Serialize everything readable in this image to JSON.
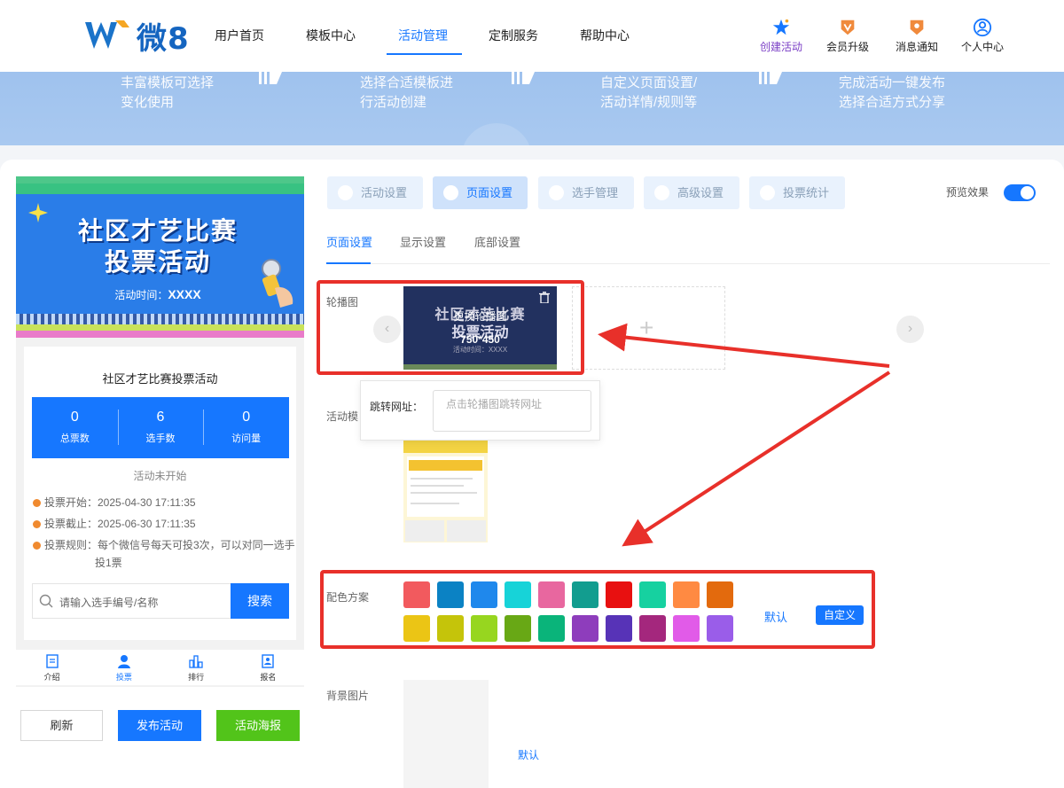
{
  "brand": {
    "logo_text": "微8"
  },
  "nav": {
    "items": [
      "用户首页",
      "模板中心",
      "活动管理",
      "定制服务",
      "帮助中心"
    ],
    "active": "活动管理",
    "right": [
      {
        "label": "创建活动",
        "icon": "star-icon"
      },
      {
        "label": "会员升级",
        "icon": "vip-badge-icon"
      },
      {
        "label": "消息通知",
        "icon": "bell-badge-icon"
      },
      {
        "label": "个人中心",
        "icon": "user-icon"
      }
    ]
  },
  "banner": {
    "steps": [
      [
        "丰富模板可选择",
        "变化使用"
      ],
      [
        "选择合适模板进",
        "行活动创建"
      ],
      [
        "自定义页面设置/",
        "活动详情/规则等"
      ],
      [
        "完成活动一键发布",
        "选择合适方式分享"
      ]
    ]
  },
  "preview": {
    "poster_title_1": "社区才艺比赛",
    "poster_title_2": "投票活动",
    "poster_time_label": "活动时间：",
    "poster_time_value": "XXXX",
    "activity_title": "社区才艺比赛投票活动",
    "stats": [
      {
        "value": "0",
        "label": "总票数"
      },
      {
        "value": "6",
        "label": "选手数"
      },
      {
        "value": "0",
        "label": "访问量"
      }
    ],
    "status": "活动未开始",
    "rules": [
      "投票开始：2025-04-30 17:11:35",
      "投票截止：2025-06-30 17:11:35",
      "投票规则：每个微信号每天可投3次，可以对同一选手",
      "投1票"
    ],
    "search_placeholder": "请输入选手编号/名称",
    "search_button": "搜索",
    "tabs": [
      "介绍",
      "投票",
      "排行",
      "报名"
    ],
    "active_tab": "投票"
  },
  "actions": {
    "refresh": "刷新",
    "publish": "发布活动",
    "poster": "活动海报"
  },
  "settings": {
    "top_tabs": [
      "活动设置",
      "页面设置",
      "选手管理",
      "高级设置",
      "投票统计"
    ],
    "active_top_tab": "页面设置",
    "preview_label": "预览效果",
    "preview_on": true,
    "sub_tabs": [
      "页面设置",
      "显示设置",
      "底部设置"
    ],
    "active_sub_tab": "页面设置",
    "carousel_label": "轮播图",
    "carousel_overlay_1": "更换轮播图",
    "carousel_overlay_2": "750*450",
    "carousel_img_title_1": "社区才艺比赛",
    "carousel_img_title_2": "投票活动",
    "carousel_img_time": "活动时间：XXXX",
    "carousel_add": "+",
    "jump_label": "跳转网址：",
    "jump_placeholder": "点击轮播图跳转网址",
    "template_label": "活动模",
    "color_label": "配色方案",
    "colors": [
      "#f25a5e",
      "#0b82c4",
      "#1f88ec",
      "#17d3d8",
      "#e8679f",
      "#129d8f",
      "#e81010",
      "#16d1a0",
      "#ff8a42",
      "#e36a0d",
      "#ebc515",
      "#c5c40a",
      "#97d61f",
      "#68a815",
      "#0ab47a",
      "#8e3dbc",
      "#5733b7",
      "#a4277d",
      "#e15be8",
      "#9a5de9"
    ],
    "color_default": "默认",
    "color_custom": "自定义",
    "bg_label": "背景图片",
    "bg_default": "默认"
  }
}
